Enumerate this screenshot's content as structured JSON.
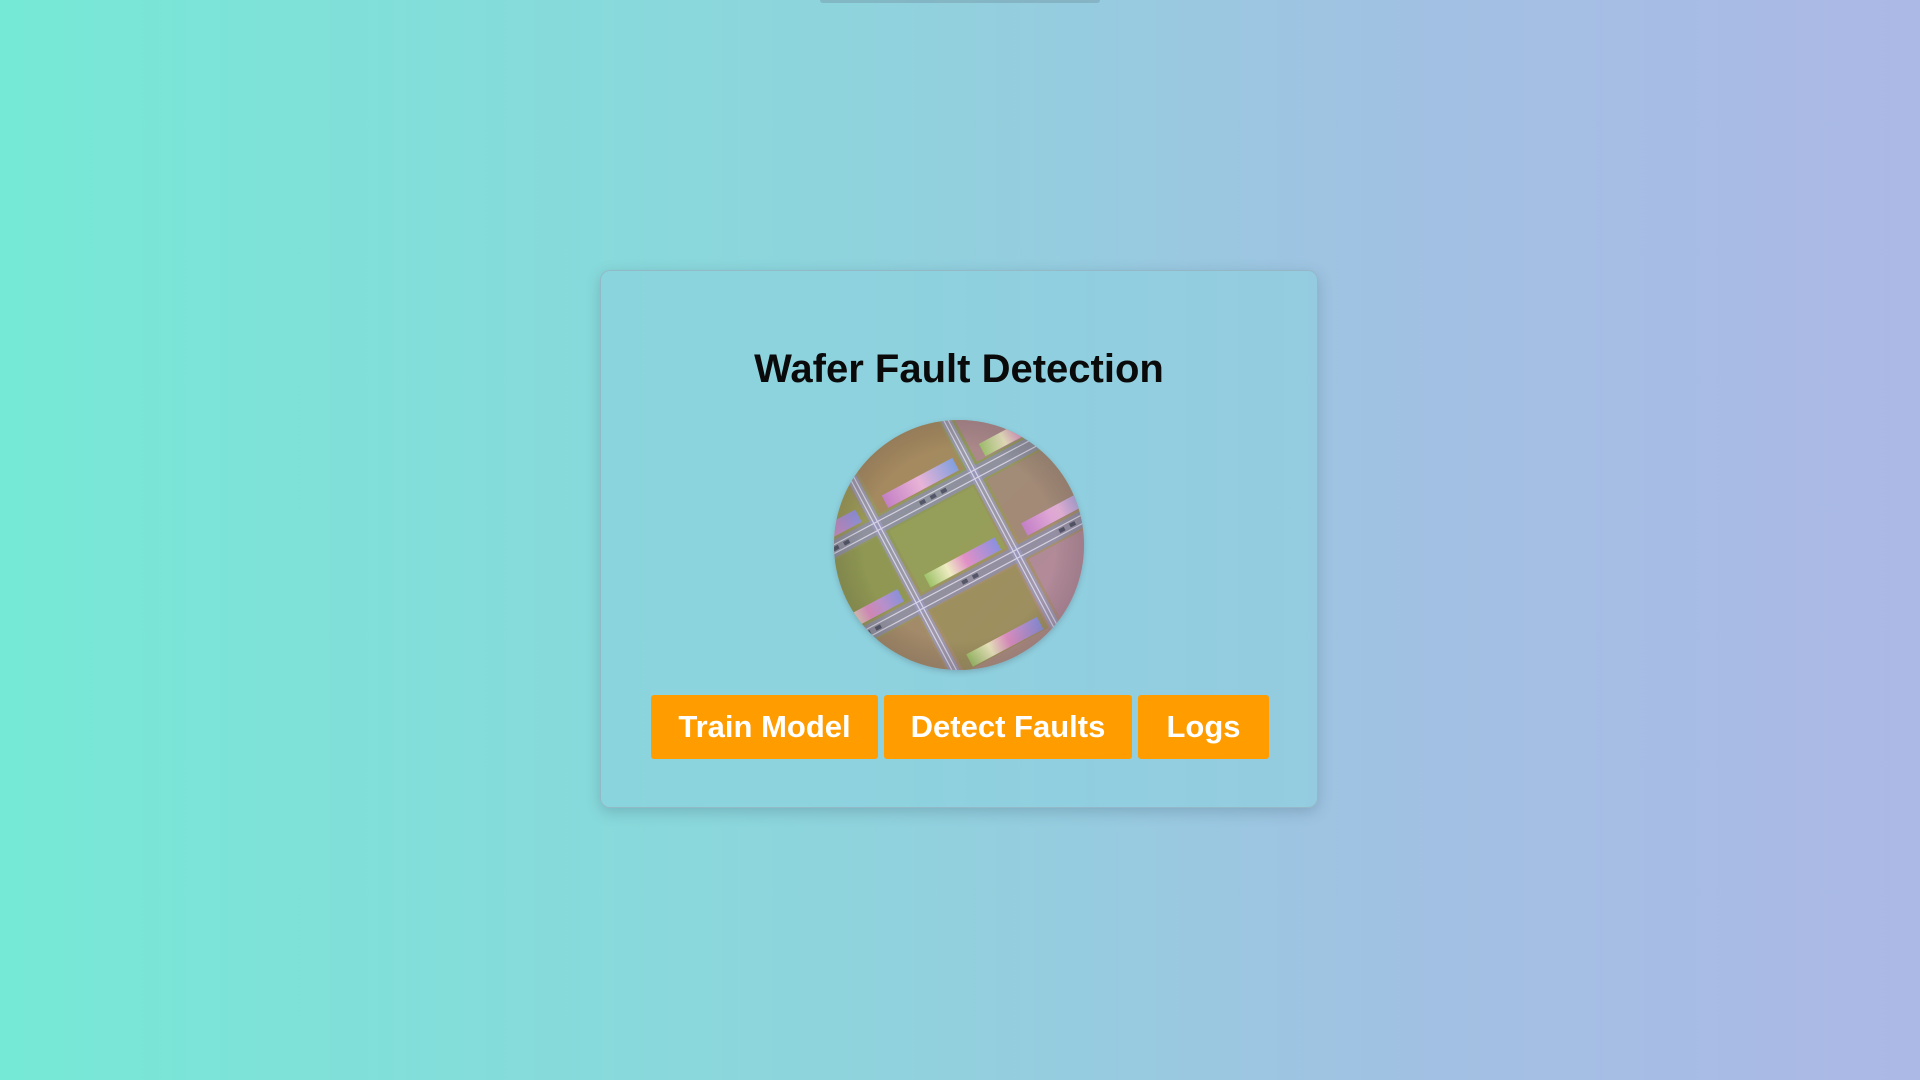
{
  "app": {
    "title": "Wafer Fault Detection"
  },
  "hero_image": {
    "icon": "semiconductor-wafer-image"
  },
  "actions": {
    "train_label": "Train Model",
    "detect_label": "Detect Faults",
    "logs_label": "Logs"
  },
  "colors": {
    "accent": "#ff9c00",
    "button_text": "#ffffff",
    "title_text": "#0a0a0a",
    "background_start": "#76e9d6",
    "background_end": "#acb8e6"
  }
}
